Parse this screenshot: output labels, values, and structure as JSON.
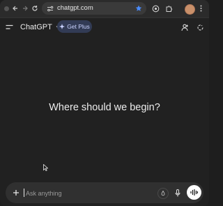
{
  "browser": {
    "url": "chatgpt.com"
  },
  "header": {
    "model_label": "ChatGPT",
    "upgrade_label": "Get Plus"
  },
  "main": {
    "heading": "Where should we begin?"
  },
  "composer": {
    "placeholder": "Ask anything"
  },
  "colors": {
    "background": "#212121",
    "composer": "#303030",
    "plus_pill": "#323b55",
    "bookmark_star": "#4a8cff"
  },
  "icons": [
    "back-icon",
    "forward-icon",
    "reload-icon",
    "site-settings-icon",
    "bookmark-star-icon",
    "extension-icon",
    "puzzle-icon",
    "avatar",
    "menu-icon",
    "chevron-down-icon",
    "sparkle-icon",
    "profile-icon",
    "new-chat-icon",
    "plus-icon",
    "tools-icon",
    "microphone-icon",
    "voice-mode-icon",
    "cursor-icon"
  ]
}
